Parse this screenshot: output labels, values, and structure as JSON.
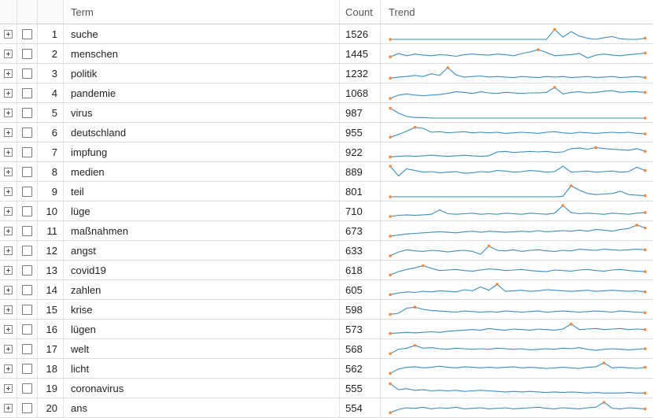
{
  "header": {
    "term": "Term",
    "count": "Count",
    "trend": "Trend"
  },
  "colors": {
    "line": "#3a8ec2",
    "marker": "#f0883e"
  },
  "rows": [
    {
      "index": "1",
      "term": "suche",
      "count": "1526",
      "trend": [
        0,
        0,
        0,
        0,
        0,
        0,
        0,
        0,
        0,
        0,
        0,
        0,
        0,
        0,
        0,
        0,
        0,
        0,
        0,
        0,
        0.9,
        0.2,
        0.7,
        0.3,
        0.1,
        0,
        0.15,
        0.25,
        0.05,
        0,
        0,
        0.1
      ]
    },
    {
      "index": "2",
      "term": "menschen",
      "count": "1445",
      "trend": [
        0.2,
        0.5,
        0.3,
        0.45,
        0.35,
        0.3,
        0.4,
        0.35,
        0.25,
        0.4,
        0.45,
        0.4,
        0.35,
        0.45,
        0.4,
        0.3,
        0.5,
        0.65,
        0.85,
        0.6,
        0.3,
        0.35,
        0.4,
        0.5,
        0.1,
        0.35,
        0.45,
        0.35,
        0.3,
        0.4,
        0.45,
        0.55
      ]
    },
    {
      "index": "3",
      "term": "politik",
      "count": "1232",
      "trend": [
        0.05,
        0.15,
        0.2,
        0.3,
        0.2,
        0.45,
        0.3,
        1,
        0.35,
        0.15,
        0.2,
        0.25,
        0.15,
        0.2,
        0.15,
        0.1,
        0.2,
        0.15,
        0.1,
        0.2,
        0.15,
        0.2,
        0.1,
        0.15,
        0.2,
        0.1,
        0.15,
        0.2,
        0.1,
        0.15,
        0.2,
        0.1
      ]
    },
    {
      "index": "4",
      "term": "pandemie",
      "count": "1068",
      "trend": [
        0,
        0.3,
        0.4,
        0.3,
        0.25,
        0.3,
        0.35,
        0.45,
        0.6,
        0.55,
        0.45,
        0.6,
        0.5,
        0.45,
        0.55,
        0.5,
        0.45,
        0.5,
        0.5,
        0.55,
        1,
        0.4,
        0.55,
        0.6,
        0.5,
        0.55,
        0.65,
        0.7,
        0.55,
        0.6,
        0.6,
        0.55
      ]
    },
    {
      "index": "5",
      "term": "virus",
      "count": "987",
      "trend": [
        0.9,
        0.45,
        0.15,
        0.05,
        0.05,
        0,
        0,
        0,
        0,
        0,
        0,
        0,
        0,
        0,
        0,
        0,
        0,
        0,
        0,
        0,
        0,
        0,
        0,
        0,
        0,
        0,
        0,
        0,
        0,
        0,
        0,
        0
      ]
    },
    {
      "index": "6",
      "term": "deutschland",
      "count": "955",
      "trend": [
        0.05,
        0.3,
        0.6,
        0.95,
        0.85,
        0.5,
        0.55,
        0.45,
        0.5,
        0.55,
        0.45,
        0.5,
        0.45,
        0.5,
        0.4,
        0.45,
        0.5,
        0.45,
        0.4,
        0.5,
        0.55,
        0.45,
        0.4,
        0.5,
        0.45,
        0.4,
        0.45,
        0.5,
        0.45,
        0.5,
        0.4,
        0.35
      ]
    },
    {
      "index": "7",
      "term": "impfung",
      "count": "922",
      "trend": [
        0.05,
        0.1,
        0.15,
        0.1,
        0.15,
        0.2,
        0.15,
        0.1,
        0.15,
        0.2,
        0.15,
        0.1,
        0.15,
        0.5,
        0.55,
        0.45,
        0.5,
        0.55,
        0.5,
        0.55,
        0.45,
        0.5,
        0.8,
        0.85,
        0.75,
        0.9,
        0.8,
        0.75,
        0.7,
        0.65,
        0.8,
        0.55
      ]
    },
    {
      "index": "8",
      "term": "medien",
      "count": "889",
      "trend": [
        1,
        0.1,
        0.75,
        0.6,
        0.45,
        0.5,
        0.4,
        0.45,
        0.5,
        0.35,
        0.4,
        0.5,
        0.45,
        0.6,
        0.55,
        0.45,
        0.5,
        0.6,
        0.55,
        0.45,
        0.5,
        1,
        0.45,
        0.5,
        0.55,
        0.45,
        0.5,
        0.55,
        0.45,
        0.5,
        0.9,
        0.6
      ]
    },
    {
      "index": "9",
      "term": "teil",
      "count": "801",
      "trend": [
        0,
        0,
        0,
        0,
        0,
        0,
        0,
        0,
        0,
        0,
        0,
        0,
        0,
        0,
        0,
        0,
        0,
        0,
        0,
        0,
        0,
        0.05,
        1,
        0.6,
        0.3,
        0.2,
        0.25,
        0.3,
        0.5,
        0.2,
        0.15,
        0.1
      ]
    },
    {
      "index": "10",
      "term": "lüge",
      "count": "710",
      "trend": [
        0,
        0.1,
        0.15,
        0.1,
        0.15,
        0.2,
        0.6,
        0.25,
        0.2,
        0.25,
        0.3,
        0.2,
        0.25,
        0.2,
        0.3,
        0.25,
        0.2,
        0.3,
        0.25,
        0.2,
        0.3,
        1,
        0.35,
        0.25,
        0.3,
        0.25,
        0.2,
        0.3,
        0.25,
        0.2,
        0.3,
        0.35
      ]
    },
    {
      "index": "11",
      "term": "maßnahmen",
      "count": "673",
      "trend": [
        0,
        0.1,
        0.2,
        0.25,
        0.3,
        0.35,
        0.4,
        0.35,
        0.3,
        0.4,
        0.45,
        0.35,
        0.45,
        0.4,
        0.35,
        0.4,
        0.45,
        0.4,
        0.5,
        0.4,
        0.45,
        0.5,
        0.45,
        0.55,
        0.45,
        0.6,
        0.55,
        0.45,
        0.6,
        0.7,
        1,
        0.75
      ]
    },
    {
      "index": "12",
      "term": "angst",
      "count": "633",
      "trend": [
        0,
        0.35,
        0.55,
        0.45,
        0.4,
        0.5,
        0.45,
        0.35,
        0.45,
        0.5,
        0.4,
        0.15,
        0.9,
        0.5,
        0.45,
        0.55,
        0.4,
        0.5,
        0.55,
        0.45,
        0.4,
        0.5,
        0.45,
        0.6,
        0.55,
        0.5,
        0.6,
        0.55,
        0.5,
        0.55,
        0.6,
        0.55
      ]
    },
    {
      "index": "13",
      "term": "covid19",
      "count": "618",
      "trend": [
        0.05,
        0.35,
        0.55,
        0.7,
        0.9,
        0.65,
        0.45,
        0.5,
        0.55,
        0.45,
        0.4,
        0.5,
        0.6,
        0.55,
        0.45,
        0.5,
        0.55,
        0.45,
        0.4,
        0.35,
        0.5,
        0.45,
        0.4,
        0.5,
        0.55,
        0.45,
        0.4,
        0.5,
        0.55,
        0.45,
        0.4,
        0.35
      ]
    },
    {
      "index": "14",
      "term": "zahlen",
      "count": "605",
      "trend": [
        0.05,
        0.2,
        0.3,
        0.25,
        0.35,
        0.3,
        0.4,
        0.35,
        0.3,
        0.5,
        0.4,
        0.75,
        0.45,
        1,
        0.35,
        0.4,
        0.45,
        0.35,
        0.4,
        0.5,
        0.45,
        0.4,
        0.35,
        0.4,
        0.45,
        0.35,
        0.4,
        0.45,
        0.4,
        0.35,
        0.4,
        0.3
      ]
    },
    {
      "index": "15",
      "term": "krise",
      "count": "598",
      "trend": [
        0.05,
        0.15,
        0.6,
        0.7,
        0.5,
        0.4,
        0.35,
        0.3,
        0.25,
        0.35,
        0.3,
        0.25,
        0.3,
        0.25,
        0.35,
        0.3,
        0.25,
        0.3,
        0.35,
        0.25,
        0.3,
        0.35,
        0.3,
        0.25,
        0.3,
        0.35,
        0.3,
        0.25,
        0.35,
        0.3,
        0.25,
        0.2
      ]
    },
    {
      "index": "16",
      "term": "lügen",
      "count": "573",
      "trend": [
        0.1,
        0.15,
        0.2,
        0.15,
        0.2,
        0.25,
        0.2,
        0.3,
        0.35,
        0.4,
        0.45,
        0.4,
        0.55,
        0.45,
        0.4,
        0.5,
        0.45,
        0.4,
        0.5,
        0.45,
        0.4,
        0.5,
        0.95,
        0.45,
        0.5,
        0.55,
        0.45,
        0.5,
        0.55,
        0.45,
        0.5,
        0.45
      ]
    },
    {
      "index": "17",
      "term": "welt",
      "count": "568",
      "trend": [
        0.05,
        0.45,
        0.55,
        0.8,
        0.55,
        0.6,
        0.5,
        0.45,
        0.55,
        0.5,
        0.45,
        0.5,
        0.45,
        0.55,
        0.5,
        0.45,
        0.5,
        0.4,
        0.45,
        0.5,
        0.45,
        0.55,
        0.5,
        0.6,
        0.45,
        0.35,
        0.45,
        0.5,
        0.45,
        0.4,
        0.45,
        0.5
      ]
    },
    {
      "index": "18",
      "term": "licht",
      "count": "562",
      "trend": [
        0.05,
        0.45,
        0.6,
        0.65,
        0.55,
        0.6,
        0.7,
        0.6,
        0.55,
        0.65,
        0.6,
        0.55,
        0.6,
        0.55,
        0.6,
        0.65,
        0.55,
        0.6,
        0.55,
        0.5,
        0.55,
        0.6,
        0.55,
        0.5,
        0.6,
        0.65,
        1,
        0.55,
        0.6,
        0.55,
        0.5,
        0.6
      ]
    },
    {
      "index": "19",
      "term": "coronavirus",
      "count": "555",
      "trend": [
        0.9,
        0.35,
        0.45,
        0.3,
        0.35,
        0.25,
        0.3,
        0.25,
        0.3,
        0.2,
        0.25,
        0.3,
        0.25,
        0.2,
        0.15,
        0.2,
        0.15,
        0.2,
        0.15,
        0.1,
        0.15,
        0.1,
        0.15,
        0.1,
        0.05,
        0.1,
        0.05,
        0.05,
        0.05,
        0.1,
        0.05,
        0.05
      ]
    },
    {
      "index": "20",
      "term": "ans",
      "count": "554",
      "trend": [
        0.05,
        0.35,
        0.5,
        0.45,
        0.55,
        0.4,
        0.5,
        0.45,
        0.55,
        0.4,
        0.45,
        0.5,
        0.4,
        0.45,
        0.5,
        0.4,
        0.45,
        0.5,
        0.55,
        0.45,
        0.4,
        0.5,
        0.45,
        0.4,
        0.5,
        0.55,
        1,
        0.45,
        0.4,
        0.5,
        0.45,
        0.4
      ]
    }
  ]
}
